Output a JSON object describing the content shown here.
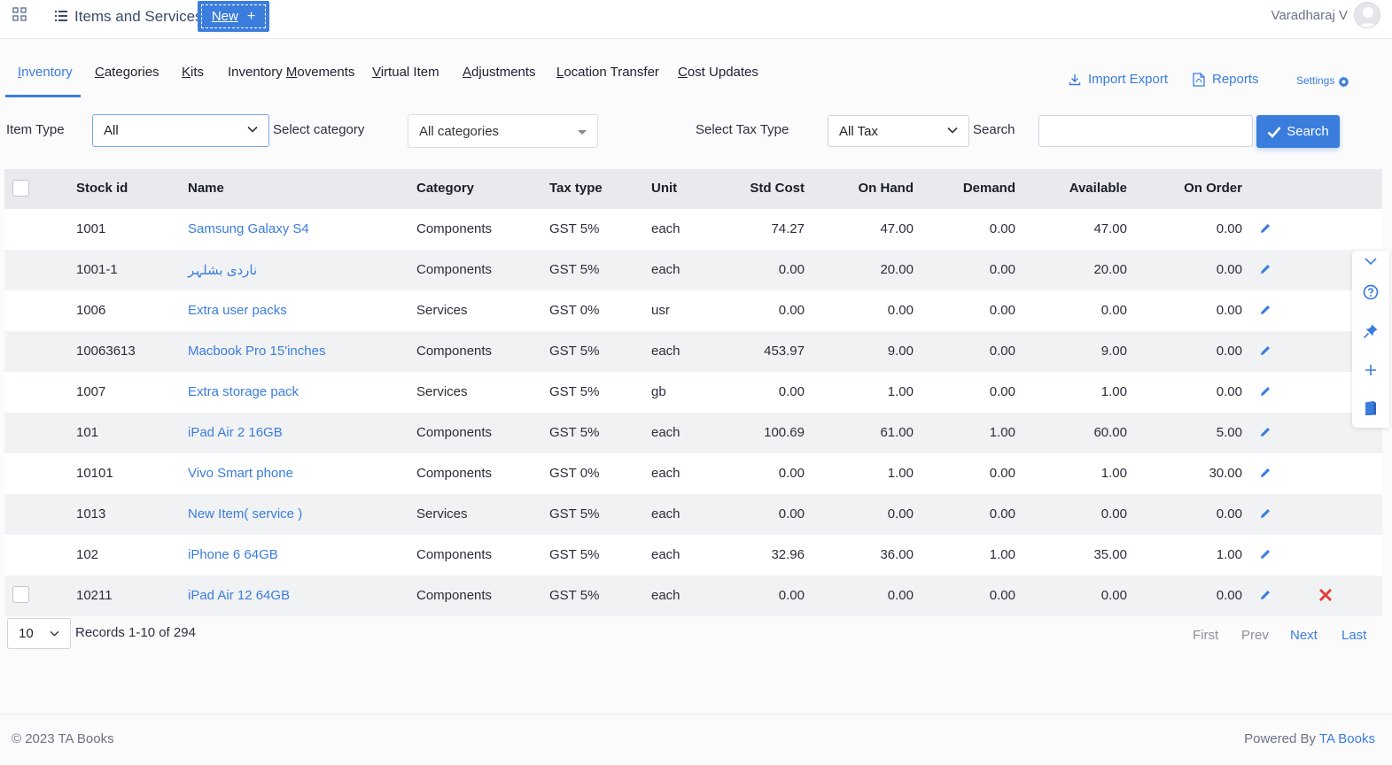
{
  "header": {
    "title": "Items and Services",
    "new_label": "New",
    "new_plus": "+",
    "user_name": "Varadharaj V"
  },
  "tabs": [
    {
      "pre": "",
      "u": "I",
      "post": "nventory"
    },
    {
      "pre": "",
      "u": "C",
      "post": "ategories"
    },
    {
      "pre": "",
      "u": "K",
      "post": "its"
    },
    {
      "pre": "Inventory ",
      "u": "M",
      "post": "ovements"
    },
    {
      "pre": "",
      "u": "V",
      "post": "irtual Item"
    },
    {
      "pre": "",
      "u": "A",
      "post": "djustments"
    },
    {
      "pre": "",
      "u": "L",
      "post": "ocation Transfer"
    },
    {
      "pre": "",
      "u": "C",
      "post": "ost Updates"
    }
  ],
  "actions": {
    "import_export": "Import Export",
    "reports": "Reports",
    "settings": "Settings"
  },
  "filters": {
    "item_type_label": "Item Type",
    "item_type_value": "All",
    "category_label": "Select category",
    "category_value": "All categories",
    "tax_label": "Select Tax Type",
    "tax_value": "All Tax",
    "search_label": "Search",
    "search_value": "",
    "search_button": "Search"
  },
  "table": {
    "columns": [
      "Stock id",
      "Name",
      "Category",
      "Tax type",
      "Unit",
      "Std Cost",
      "On Hand",
      "Demand",
      "Available",
      "On Order"
    ],
    "rows": [
      {
        "stock_id": "1001",
        "name": "Samsung Galaxy S4",
        "category": "Components",
        "tax": "GST 5%",
        "unit": "each",
        "std_cost": "74.27",
        "on_hand": "47.00",
        "demand": "0.00",
        "available": "47.00",
        "on_order": "0.00"
      },
      {
        "stock_id": "1001-1",
        "name": "ناردی بشلہر",
        "category": "Components",
        "tax": "GST 5%",
        "unit": "each",
        "std_cost": "0.00",
        "on_hand": "20.00",
        "demand": "0.00",
        "available": "20.00",
        "on_order": "0.00"
      },
      {
        "stock_id": "1006",
        "name": "Extra user packs",
        "category": "Services",
        "tax": "GST 0%",
        "unit": "usr",
        "std_cost": "0.00",
        "on_hand": "0.00",
        "demand": "0.00",
        "available": "0.00",
        "on_order": "0.00"
      },
      {
        "stock_id": "10063613",
        "name": "Macbook Pro 15'inches",
        "category": "Components",
        "tax": "GST 5%",
        "unit": "each",
        "std_cost": "453.97",
        "on_hand": "9.00",
        "demand": "0.00",
        "available": "9.00",
        "on_order": "0.00"
      },
      {
        "stock_id": "1007",
        "name": "Extra storage pack",
        "category": "Services",
        "tax": "GST 5%",
        "unit": "gb",
        "std_cost": "0.00",
        "on_hand": "1.00",
        "demand": "0.00",
        "available": "1.00",
        "on_order": "0.00"
      },
      {
        "stock_id": "101",
        "name": "iPad Air 2 16GB",
        "category": "Components",
        "tax": "GST 5%",
        "unit": "each",
        "std_cost": "100.69",
        "on_hand": "61.00",
        "demand": "1.00",
        "available": "60.00",
        "on_order": "5.00"
      },
      {
        "stock_id": "10101",
        "name": "Vivo Smart phone",
        "category": "Components",
        "tax": "GST 0%",
        "unit": "each",
        "std_cost": "0.00",
        "on_hand": "1.00",
        "demand": "0.00",
        "available": "1.00",
        "on_order": "30.00"
      },
      {
        "stock_id": "1013",
        "name": "New Item( service )",
        "category": "Services",
        "tax": "GST 5%",
        "unit": "each",
        "std_cost": "0.00",
        "on_hand": "0.00",
        "demand": "0.00",
        "available": "0.00",
        "on_order": "0.00"
      },
      {
        "stock_id": "102",
        "name": "iPhone 6 64GB",
        "category": "Components",
        "tax": "GST 5%",
        "unit": "each",
        "std_cost": "32.96",
        "on_hand": "36.00",
        "demand": "1.00",
        "available": "35.00",
        "on_order": "1.00"
      },
      {
        "stock_id": "10211",
        "name": "iPad Air 12 64GB",
        "category": "Components",
        "tax": "GST 5%",
        "unit": "each",
        "std_cost": "0.00",
        "on_hand": "0.00",
        "demand": "0.00",
        "available": "0.00",
        "on_order": "0.00"
      }
    ]
  },
  "pagination": {
    "per_page": "10",
    "records": "Records 1-10 of 294",
    "first": "First",
    "prev": "Prev",
    "next": "Next",
    "last": "Last"
  },
  "footer": {
    "copyright": "© 2023 TA Books",
    "powered_by": "Powered By",
    "brand": "TA Books"
  },
  "colors": {
    "accent": "#3b7ddd",
    "delete": "#e53935"
  }
}
